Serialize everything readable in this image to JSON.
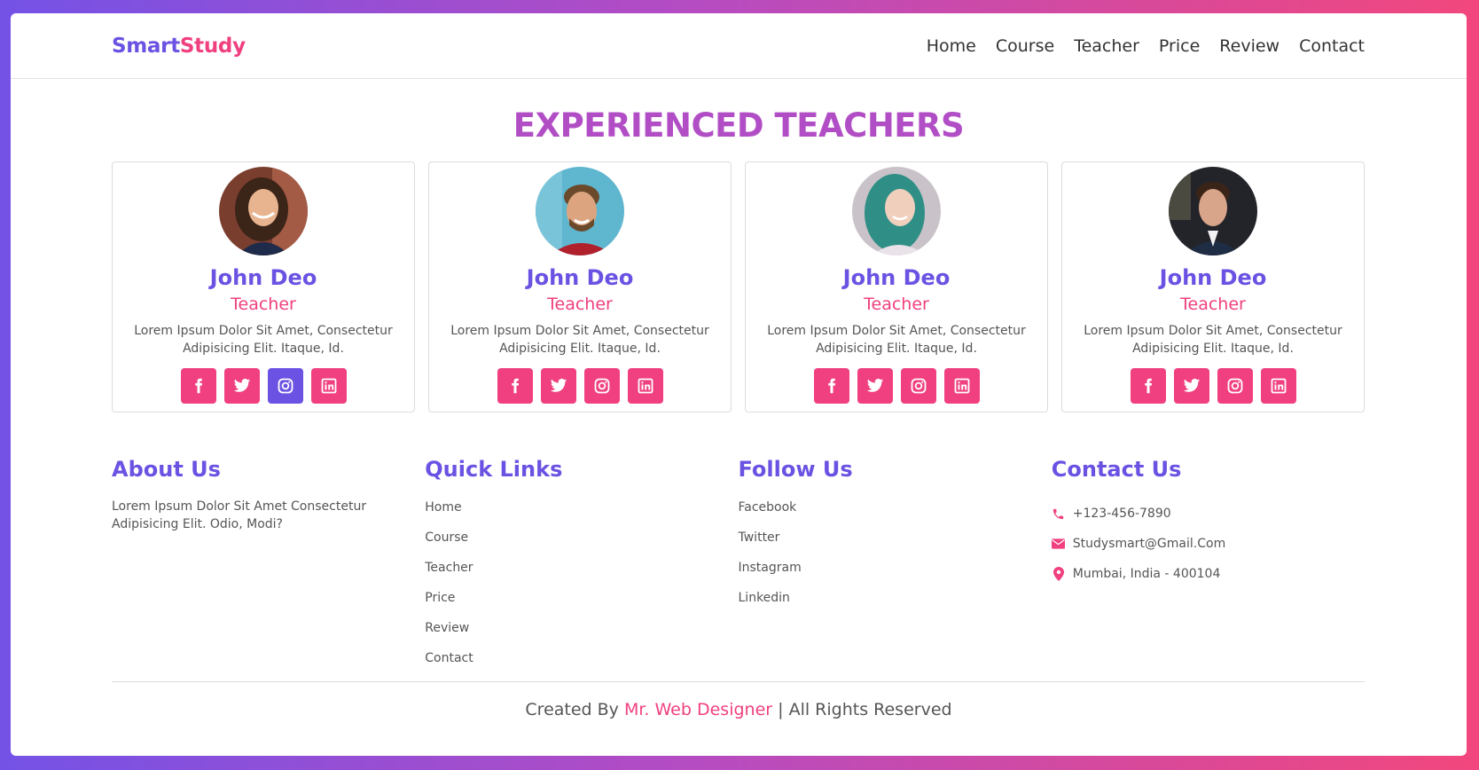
{
  "brand": {
    "part1": "Smart",
    "part2": "Study"
  },
  "nav": [
    "Home",
    "Course",
    "Teacher",
    "Price",
    "Review",
    "Contact"
  ],
  "section_title": "EXPERIENCED TEACHERS",
  "teachers": [
    {
      "name": "John Deo",
      "role": "Teacher",
      "desc": "Lorem Ipsum Dolor Sit Amet, Consectetur Adipisicing Elit. Itaque, Id."
    },
    {
      "name": "John Deo",
      "role": "Teacher",
      "desc": "Lorem Ipsum Dolor Sit Amet, Consectetur Adipisicing Elit. Itaque, Id."
    },
    {
      "name": "John Deo",
      "role": "Teacher",
      "desc": "Lorem Ipsum Dolor Sit Amet, Consectetur Adipisicing Elit. Itaque, Id."
    },
    {
      "name": "John Deo",
      "role": "Teacher",
      "desc": "Lorem Ipsum Dolor Sit Amet, Consectetur Adipisicing Elit. Itaque, Id."
    }
  ],
  "social_icons": [
    "facebook-icon",
    "twitter-icon",
    "instagram-icon",
    "linkedin-icon"
  ],
  "footer": {
    "about": {
      "title": "About Us",
      "text": "Lorem Ipsum Dolor Sit Amet Consectetur Adipisicing Elit. Odio, Modi?"
    },
    "quick_links": {
      "title": "Quick Links",
      "items": [
        "Home",
        "Course",
        "Teacher",
        "Price",
        "Review",
        "Contact"
      ]
    },
    "follow": {
      "title": "Follow Us",
      "items": [
        "Facebook",
        "Twitter",
        "Instagram",
        "Linkedin"
      ]
    },
    "contact": {
      "title": "Contact Us",
      "phone": "+123-456-7890",
      "email": "Studysmart@Gmail.Com",
      "address": "Mumbai, India - 400104"
    }
  },
  "copyright": {
    "prefix": "Created By",
    "brand": "Mr. Web Designer",
    "suffix": "| All Rights Reserved"
  },
  "colors": {
    "primary": "#6b52e3",
    "accent": "#f0407f",
    "title": "#b24ec5"
  }
}
